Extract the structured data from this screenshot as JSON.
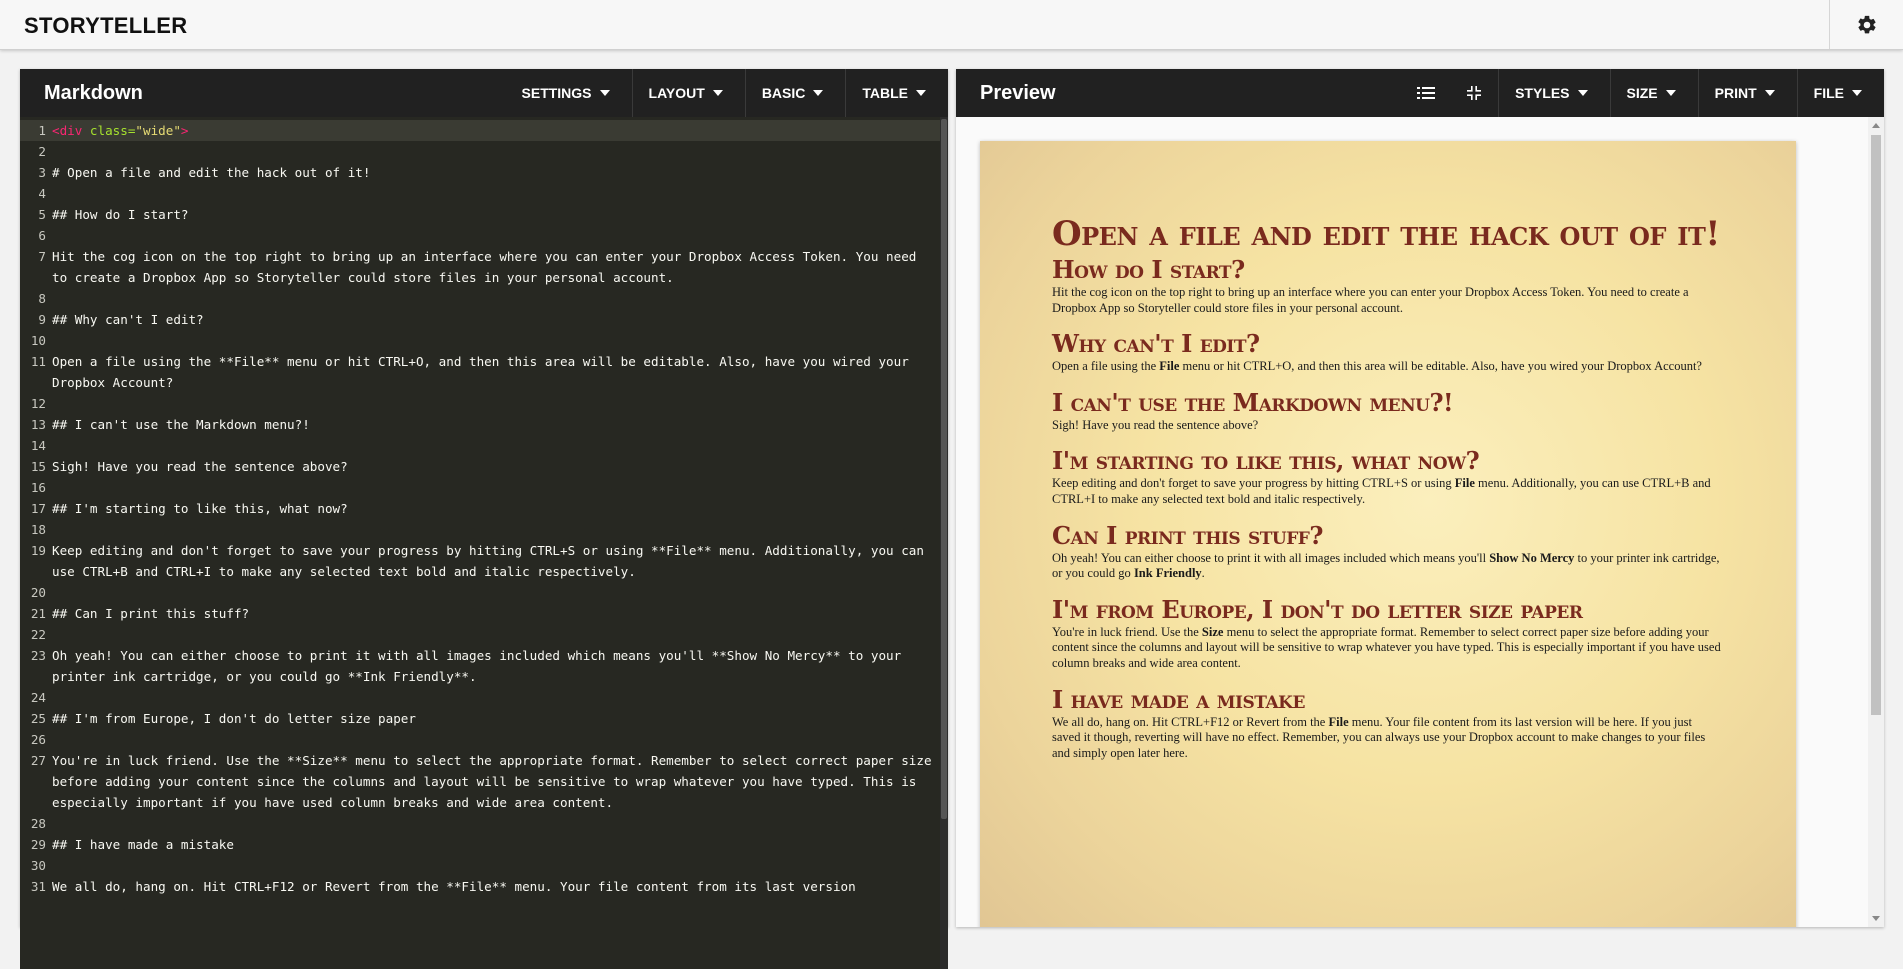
{
  "app": {
    "title": "STORYTELLER"
  },
  "markdown_panel": {
    "title": "Markdown",
    "menus": [
      "SETTINGS",
      "LAYOUT",
      "BASIC",
      "TABLE"
    ],
    "lines": [
      {
        "n": "1",
        "t": ""
      },
      {
        "n": "2",
        "t": ""
      },
      {
        "n": "3",
        "t": "# Open a file and edit the hack out of it!"
      },
      {
        "n": "4",
        "t": ""
      },
      {
        "n": "5",
        "t": "## How do I start?"
      },
      {
        "n": "6",
        "t": ""
      },
      {
        "n": "7",
        "t": "Hit the cog icon on the top right to bring up an interface where you can enter your Dropbox Access Token. You need to create a Dropbox App so Storyteller could store files in your personal account."
      },
      {
        "n": "8",
        "t": ""
      },
      {
        "n": "9",
        "t": "## Why can't I edit?"
      },
      {
        "n": "10",
        "t": ""
      },
      {
        "n": "11",
        "t": "Open a file using the **File** menu or hit CTRL+O, and then this area will be editable. Also, have you wired your Dropbox Account?"
      },
      {
        "n": "12",
        "t": ""
      },
      {
        "n": "13",
        "t": "## I can't use the Markdown menu?!"
      },
      {
        "n": "14",
        "t": ""
      },
      {
        "n": "15",
        "t": "Sigh! Have you read the sentence above?"
      },
      {
        "n": "16",
        "t": ""
      },
      {
        "n": "17",
        "t": "## I'm starting to like this, what now?"
      },
      {
        "n": "18",
        "t": ""
      },
      {
        "n": "19",
        "t": "Keep editing and don't forget to save your progress by hitting CTRL+S or using **File** menu. Additionally, you can use CTRL+B and CTRL+I to make any selected text bold and italic respectively."
      },
      {
        "n": "20",
        "t": ""
      },
      {
        "n": "21",
        "t": "## Can I print this stuff?"
      },
      {
        "n": "22",
        "t": ""
      },
      {
        "n": "23",
        "t": "Oh yeah! You can either choose to print it with all images included which means you'll **Show No Mercy** to your printer ink cartridge, or you could go **Ink Friendly**."
      },
      {
        "n": "24",
        "t": ""
      },
      {
        "n": "25",
        "t": "## I'm from Europe, I don't do letter size paper"
      },
      {
        "n": "26",
        "t": ""
      },
      {
        "n": "27",
        "t": "You're in luck friend. Use the **Size** menu to select the appropriate format. Remember to select correct paper size before adding your content since the columns and layout will be sensitive to wrap whatever you have typed. This is especially important if you have used column breaks and wide area content."
      },
      {
        "n": "28",
        "t": ""
      },
      {
        "n": "29",
        "t": "## I have made a mistake"
      },
      {
        "n": "30",
        "t": ""
      },
      {
        "n": "31",
        "t": "We all do, hang on. Hit CTRL+F12 or Revert from the **File** menu. Your file content from its last version"
      }
    ],
    "line1": {
      "open": "<div",
      "attr": " class=",
      "value": "\"wide\"",
      "close": ">"
    }
  },
  "preview_panel": {
    "title": "Preview",
    "menus": [
      "STYLES",
      "SIZE",
      "PRINT",
      "FILE"
    ],
    "icons": [
      "toc-icon",
      "compress-icon"
    ],
    "doc": {
      "h1": "Open a file and edit the hack out of it!",
      "sections": [
        {
          "h": "How do I start?",
          "p": [
            "Hit the cog icon on the top right to bring up an interface where you can enter your Dropbox Access Token. You need to create a Dropbox App so Storyteller could store files in your personal account."
          ]
        },
        {
          "h": "Why can't I edit?",
          "p": [
            "Open a file using the ",
            "File",
            " menu or hit CTRL+O, and then this area will be editable. Also, have you wired your Dropbox Account?"
          ]
        },
        {
          "h": "I can't use the Markdown menu?!",
          "p": [
            "Sigh! Have you read the sentence above?"
          ]
        },
        {
          "h": "I'm starting to like this, what now?",
          "p": [
            "Keep editing and don't forget to save your progress by hitting CTRL+S or using ",
            "File",
            " menu. Additionally, you can use CTRL+B and CTRL+I to make any selected text bold and italic respectively."
          ]
        },
        {
          "h": "Can I print this stuff?",
          "p": [
            "Oh yeah! You can either choose to print it with all images included which means you'll ",
            "Show No Mercy",
            " to your printer ink cartridge, or you could go ",
            "Ink Friendly",
            "."
          ]
        },
        {
          "h": "I'm from Europe, I don't do letter size paper",
          "p": [
            "You're in luck friend. Use the ",
            "Size",
            " menu to select the appropriate format. Remember to select correct paper size before adding your content since the columns and layout will be sensitive to wrap whatever you have typed. This is especially important if you have used column breaks and wide area content."
          ]
        },
        {
          "h": "I have made a mistake",
          "p": [
            "We all do, hang on. Hit CTRL+F12 or Revert from the ",
            "File",
            " menu. Your file content from its last version will be here. If you just saved it though, reverting will have no effect. Remember, you can always use your Dropbox account to make changes to your files and simply open later here."
          ]
        }
      ]
    }
  },
  "colors": {
    "toolbar": "#212121",
    "editor_bg": "#272822",
    "heading": "#7a2a1e",
    "parchment": "#f6e3a3"
  }
}
